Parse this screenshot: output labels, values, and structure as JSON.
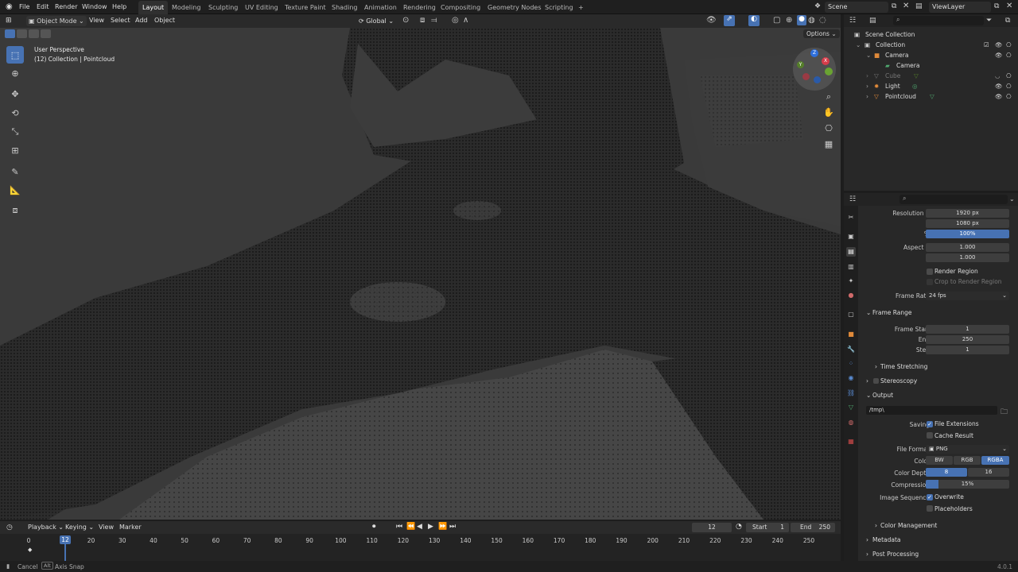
{
  "topbar": {
    "menus": [
      "File",
      "Edit",
      "Render",
      "Window",
      "Help"
    ],
    "workspaces": [
      "Layout",
      "Modeling",
      "Sculpting",
      "UV Editing",
      "Texture Paint",
      "Shading",
      "Animation",
      "Rendering",
      "Compositing",
      "Geometry Nodes",
      "Scripting"
    ],
    "active_workspace": "Layout",
    "add_tab": "+",
    "scene": "Scene",
    "view_layer": "ViewLayer"
  },
  "viewport_header": {
    "mode": "Object Mode",
    "menus": [
      "View",
      "Select",
      "Add",
      "Object"
    ],
    "transform_orientation": "Global",
    "options": "Options"
  },
  "viewport": {
    "perspective": "User Perspective",
    "collection_info": "(12) Collection | Pointcloud"
  },
  "outliner": {
    "root": "Scene Collection",
    "items": [
      {
        "label": "Collection",
        "depth": 0
      },
      {
        "label": "Camera",
        "depth": 1
      },
      {
        "label": "Camera",
        "depth": 2
      },
      {
        "label": "Cube",
        "depth": 1
      },
      {
        "label": "Light",
        "depth": 1
      },
      {
        "label": "Pointcloud",
        "depth": 1
      }
    ]
  },
  "properties": {
    "resolution_x_label": "Resolution X",
    "resolution_x": "1920 px",
    "resolution_y_label": "Y",
    "resolution_y": "1080 px",
    "percent_label": "%",
    "percent": "100%",
    "aspect_x_label": "Aspect X",
    "aspect_x": "1.000",
    "aspect_y_label": "Y",
    "aspect_y": "1.000",
    "render_region": "Render Region",
    "crop_region": "Crop to Render Region",
    "frame_rate_label": "Frame Rate",
    "frame_rate": "24 fps",
    "frame_range_title": "Frame Range",
    "frame_start_label": "Frame Start",
    "frame_start": "1",
    "end_label": "End",
    "end": "250",
    "step_label": "Step",
    "step": "1",
    "time_stretching": "Time Stretching",
    "stereoscopy": "Stereoscopy",
    "output_title": "Output",
    "output_path": "/tmp\\",
    "saving_label": "Saving",
    "file_extensions": "File Extensions",
    "cache_result": "Cache Result",
    "file_format_label": "File Format",
    "file_format": "PNG",
    "color_label": "Color",
    "color_options": [
      "BW",
      "RGB",
      "RGBA"
    ],
    "color_depth_label": "Color Depth",
    "color_depth_options": [
      "8",
      "16"
    ],
    "compression_label": "Compression",
    "compression": "15%",
    "compression_value": 0.15,
    "image_sequence_label": "Image Sequence",
    "overwrite": "Overwrite",
    "placeholders": "Placeholders",
    "color_management": "Color Management",
    "metadata": "Metadata",
    "post_processing": "Post Processing"
  },
  "timeline": {
    "menus": [
      "Playback",
      "Keying",
      "View",
      "Marker"
    ],
    "current_frame": "12",
    "start_label": "Start",
    "start": "1",
    "end_label": "End",
    "end": "250",
    "ticks": [
      "0",
      "20",
      "30",
      "40",
      "50",
      "60",
      "70",
      "80",
      "90",
      "100",
      "110",
      "120",
      "130",
      "140",
      "150",
      "160",
      "170",
      "180",
      "190",
      "200",
      "210",
      "220",
      "230",
      "240",
      "250"
    ],
    "playhead_label": "12"
  },
  "statusbar": {
    "cancel": "Cancel",
    "alt_key": "Alt",
    "axis_snap": "Axis Snap",
    "version": "4.0.1"
  },
  "colors": {
    "accent": "#4772b3",
    "panel": "#282828",
    "background": "#1d1d1d"
  }
}
